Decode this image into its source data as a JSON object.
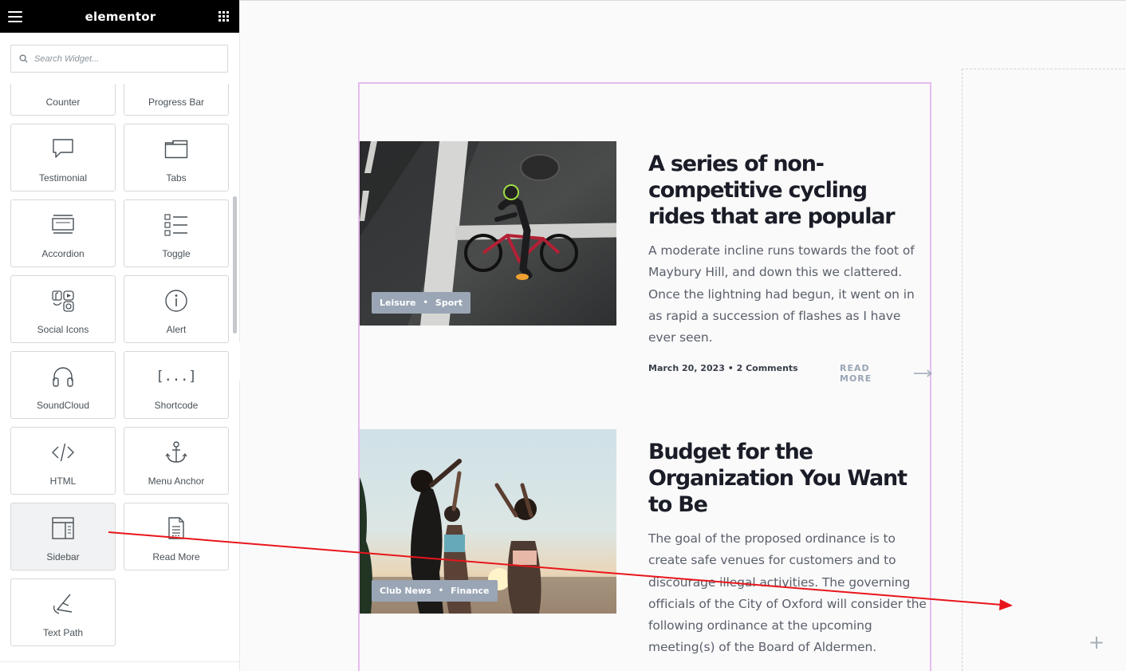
{
  "panel": {
    "brand": "elementor",
    "search_placeholder": "Search Widget...",
    "widgets": [
      {
        "label": "Counter",
        "icon": "counter-icon"
      },
      {
        "label": "Progress Bar",
        "icon": "progress-bar-icon"
      },
      {
        "label": "Testimonial",
        "icon": "speech-bubble-icon"
      },
      {
        "label": "Tabs",
        "icon": "tabs-icon"
      },
      {
        "label": "Accordion",
        "icon": "accordion-icon"
      },
      {
        "label": "Toggle",
        "icon": "toggle-list-icon"
      },
      {
        "label": "Social Icons",
        "icon": "social-icons-icon"
      },
      {
        "label": "Alert",
        "icon": "info-circle-icon"
      },
      {
        "label": "SoundCloud",
        "icon": "headphones-icon"
      },
      {
        "label": "Shortcode",
        "icon": "shortcode-icon"
      },
      {
        "label": "HTML",
        "icon": "code-icon"
      },
      {
        "label": "Menu Anchor",
        "icon": "anchor-icon"
      },
      {
        "label": "Sidebar",
        "icon": "sidebar-icon"
      },
      {
        "label": "Read More",
        "icon": "document-icon"
      },
      {
        "label": "Text Path",
        "icon": "text-path-icon"
      }
    ],
    "shortcode_glyph": "[...]"
  },
  "posts": [
    {
      "title": "A series of non-competitive cycling rides that are popular",
      "excerpt": "A moderate incline runs towards the foot of Maybury Hill, and down this we clattered. Once the lightning had begun, it went on in as rapid a succession of flashes as I have ever seen.",
      "categories": [
        "Leisure",
        "Sport"
      ],
      "meta": "March 20, 2023 • 2 Comments",
      "read_more": "READ MORE"
    },
    {
      "title": "Budget for the Organization You Want to Be",
      "excerpt": "The goal of the proposed ordinance is to create safe venues for customers and to discourage illegal activities. The governing officials of the City of Oxford will consider the following ordinance at the upcoming meeting(s) of the Board of Aldermen.",
      "categories": [
        "Club News",
        "Finance"
      ],
      "meta": "",
      "read_more": ""
    }
  ],
  "canvas": {
    "add_glyph": "+",
    "category_separator": "•"
  },
  "colors": {
    "drag_arrow": "#e8161b",
    "section_outline": "#e7bcf0",
    "category_badge": "#9aa6b5"
  }
}
